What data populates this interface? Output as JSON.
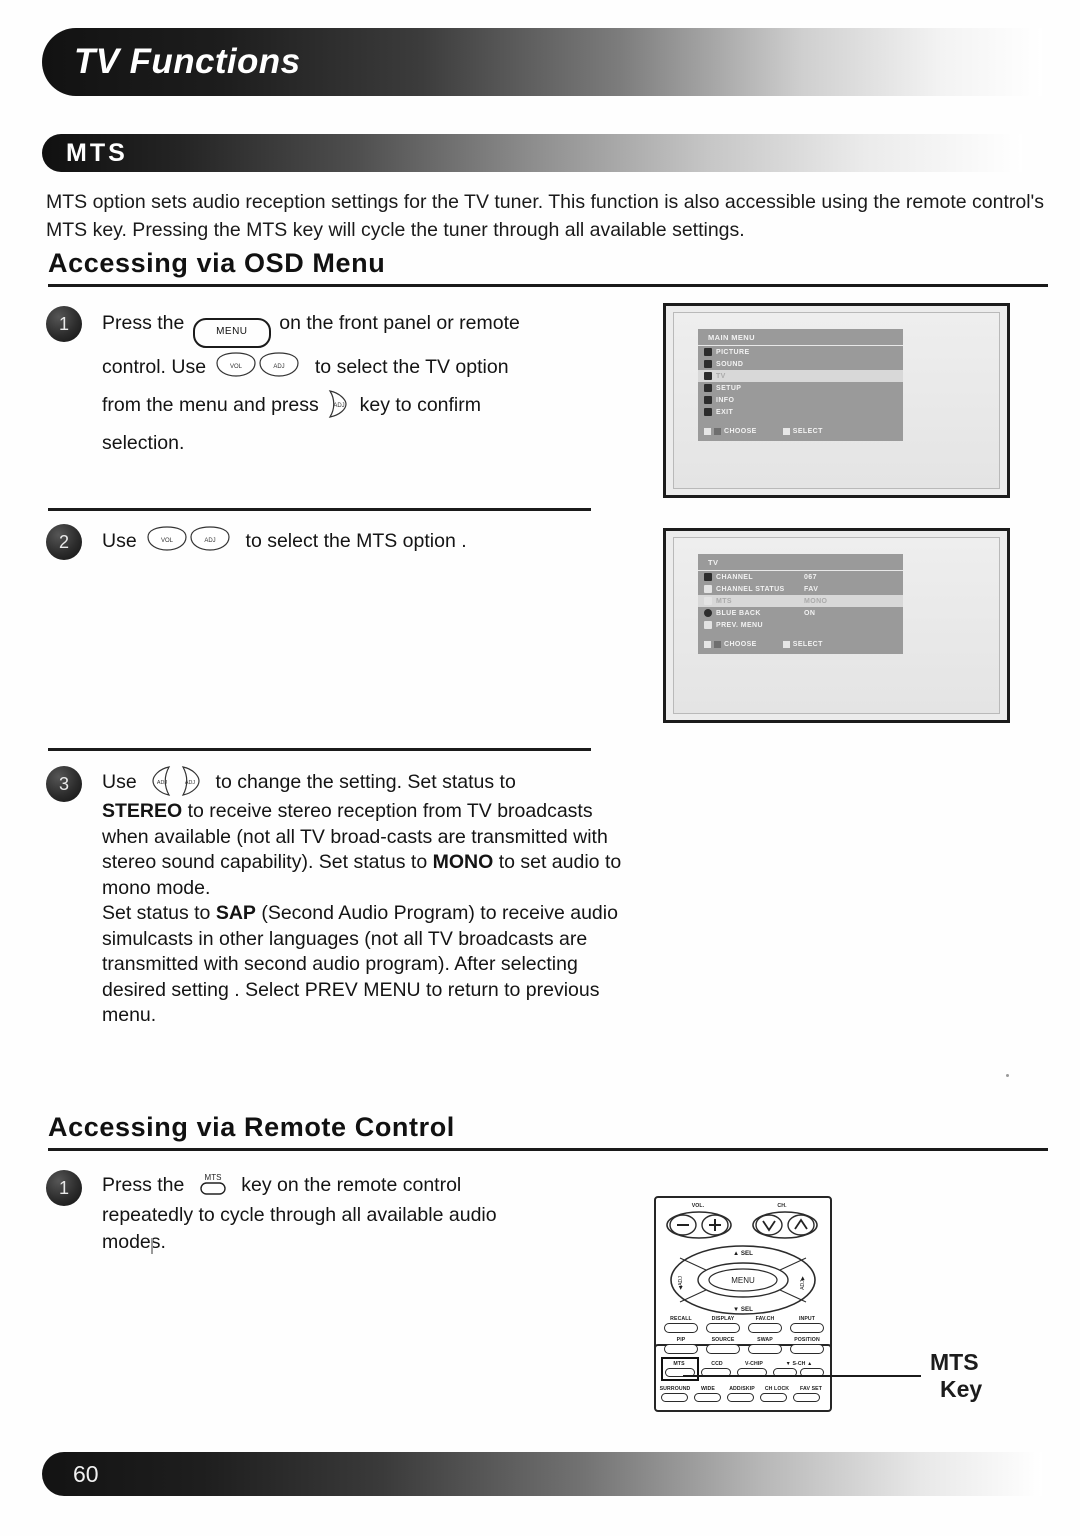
{
  "document": {
    "chapter_title": "TV Functions",
    "section_title": "MTS",
    "page_number": "60",
    "intro_paragraph": "MTS option sets audio reception settings for the TV tuner.  This function is also accessible using the remote control's MTS key.  Pressing the MTS key will cycle the tuner through all available settings."
  },
  "headings": {
    "osd": "Accessing via OSD Menu",
    "remote": "Accessing via Remote Control"
  },
  "steps": {
    "osd": [
      {
        "number": "1",
        "line1_before": "Press the",
        "key1": "MENU",
        "line1_after": "on the front panel or remote",
        "line2_before": "control.  Use",
        "line2_after": "to select the TV option",
        "line3_before": "from the menu and press",
        "line3_after": "key to confirm",
        "line4": "selection."
      },
      {
        "number": "2",
        "line1_before": "Use",
        "line1_after": "to select the MTS option ."
      },
      {
        "number": "3",
        "line1_before": "Use",
        "line1_after": "to change the setting.  Set status to",
        "bold1": "STEREO",
        "body1": " to receive stereo reception from TV broadcasts when available (not all TV broad-casts are transmitted with stereo sound capability).  Set status to ",
        "bold2": "MONO",
        "body2": " to set audio to mono mode.",
        "body3": "Set status to ",
        "bold3": "SAP",
        "body4": " (Second Audio Program) to receive audio simulcasts in other languages (not all TV broadcasts are transmitted with second audio program).  After selecting desired setting . Select PREV MENU to return to previous menu."
      }
    ],
    "remote": [
      {
        "number": "1",
        "line1_before": "Press the",
        "key_label": "MTS",
        "line1_after": "key on the remote control",
        "line2": "repeatedly to cycle through all available audio",
        "line3": "modes."
      }
    ]
  },
  "osd_screens": [
    {
      "name": "main-menu",
      "title": "MAIN MENU",
      "rows": [
        {
          "label": "PICTURE",
          "value": "",
          "highlighted": false
        },
        {
          "label": "SOUND",
          "value": "",
          "highlighted": false
        },
        {
          "label": "TV",
          "value": "",
          "highlighted": true
        },
        {
          "label": "SETUP",
          "value": "",
          "highlighted": false
        },
        {
          "label": "INFO",
          "value": "",
          "highlighted": false
        },
        {
          "label": "EXIT",
          "value": "",
          "highlighted": false
        }
      ],
      "footer_choose": "CHOOSE",
      "footer_select": "SELECT"
    },
    {
      "name": "tv-menu",
      "title": "TV",
      "rows": [
        {
          "label": "CHANNEL",
          "value": "067",
          "highlighted": false
        },
        {
          "label": "CHANNEL STATUS",
          "value": "FAV",
          "highlighted": false
        },
        {
          "label": "MTS",
          "value": "MONO",
          "highlighted": true
        },
        {
          "label": "BLUE BACK",
          "value": "ON",
          "highlighted": false
        },
        {
          "label": "PREV. MENU",
          "value": "",
          "highlighted": false
        }
      ],
      "footer_choose": "CHOOSE",
      "footer_select": "SELECT"
    }
  ],
  "remote_control": {
    "vol_label": "VOL.",
    "ch_label": "CH.",
    "vol_minus": "−",
    "vol_plus": "+",
    "ch_down": "∨",
    "ch_up": "∧",
    "sel_up": "▲ SEL",
    "sel_down": "▼ SEL",
    "menu_label": "MENU",
    "left_label": "◀ ADJ",
    "right_label": "ADJ ▶",
    "row1": [
      "RECALL",
      "DISPLAY",
      "FAV.CH",
      "INPUT"
    ],
    "row2": [
      "PIP",
      "SOURCE",
      "SWAP",
      "POSITION"
    ],
    "row3": [
      "MTS",
      "CCD",
      "V-CHIP",
      "▼ S-CH ▲"
    ],
    "row4": [
      "SURROUND",
      "WIDE",
      "ADD/SKIP",
      "CH LOCK",
      "FAV SET"
    ],
    "callout_line1": "MTS",
    "callout_line2": "Key"
  },
  "colors": {
    "bar_dark": "#121212",
    "text": "#141414",
    "osd_panel": "#9a9a9a",
    "osd_highlight": "#d8d8d8"
  }
}
